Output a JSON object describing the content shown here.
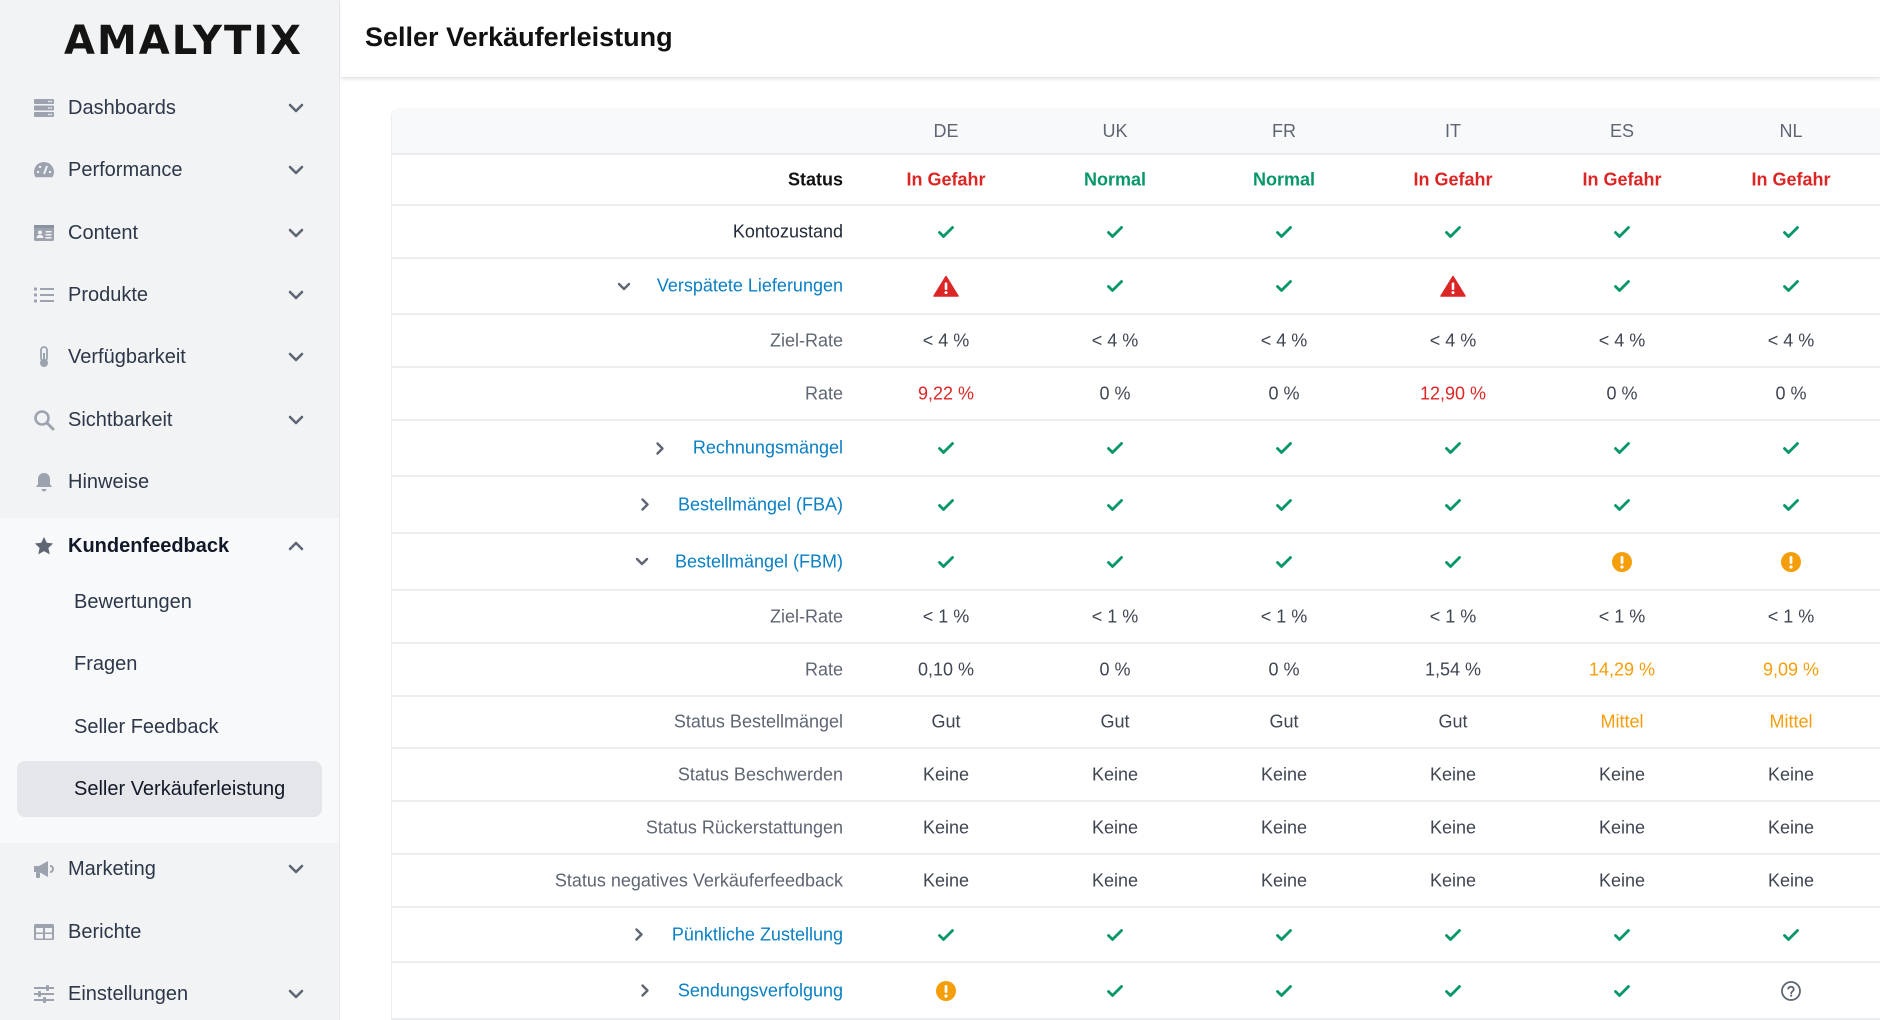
{
  "app": {
    "logo": "AMALYTIX"
  },
  "sidebar": {
    "items": [
      {
        "label": "Dashboards",
        "icon": "server-icon",
        "expandable": true,
        "expanded": false
      },
      {
        "label": "Performance",
        "icon": "gauge-icon",
        "expandable": true,
        "expanded": false
      },
      {
        "label": "Content",
        "icon": "id-card-icon",
        "expandable": true,
        "expanded": false
      },
      {
        "label": "Produkte",
        "icon": "list-icon",
        "expandable": true,
        "expanded": false
      },
      {
        "label": "Verfügbarkeit",
        "icon": "thermometer-icon",
        "expandable": true,
        "expanded": false
      },
      {
        "label": "Sichtbarkeit",
        "icon": "search-icon",
        "expandable": true,
        "expanded": false
      },
      {
        "label": "Hinweise",
        "icon": "bell-icon",
        "expandable": false
      },
      {
        "label": "Kundenfeedback",
        "icon": "star-icon",
        "expandable": true,
        "expanded": true
      },
      {
        "label": "Marketing",
        "icon": "megaphone-icon",
        "expandable": true,
        "expanded": false
      },
      {
        "label": "Berichte",
        "icon": "table-icon",
        "expandable": false
      },
      {
        "label": "Einstellungen",
        "icon": "sliders-icon",
        "expandable": true,
        "expanded": false
      }
    ],
    "kundenfeedback_children": [
      {
        "label": "Bewertungen",
        "selected": false
      },
      {
        "label": "Fragen",
        "selected": false
      },
      {
        "label": "Seller Feedback",
        "selected": false
      },
      {
        "label": "Seller Verkäuferleistung",
        "selected": true
      }
    ]
  },
  "header": {
    "title": "Seller Verkäuferleistung"
  },
  "colors": {
    "danger": "#dc2626",
    "success": "#059669",
    "warning": "#f59e0b",
    "link": "#0a7fc4"
  },
  "table": {
    "columns": [
      "DE",
      "UK",
      "FR",
      "IT",
      "ES",
      "NL"
    ],
    "rows": [
      {
        "label": "Status",
        "style": "strong",
        "cells": [
          {
            "text": "In Gefahr",
            "tone": "red",
            "bold": true
          },
          {
            "text": "Normal",
            "tone": "green",
            "bold": true
          },
          {
            "text": "Normal",
            "tone": "green",
            "bold": true
          },
          {
            "text": "In Gefahr",
            "tone": "red",
            "bold": true
          },
          {
            "text": "In Gefahr",
            "tone": "red",
            "bold": true
          },
          {
            "text": "In Gefahr",
            "tone": "red",
            "bold": true
          }
        ]
      },
      {
        "label": "Kontozustand",
        "style": "dark",
        "cells": [
          {
            "icon": "check"
          },
          {
            "icon": "check"
          },
          {
            "icon": "check"
          },
          {
            "icon": "check"
          },
          {
            "icon": "check"
          },
          {
            "icon": "check"
          }
        ]
      },
      {
        "label": "Verspätete Lieferungen",
        "style": "link",
        "toggle": "expanded",
        "tall": true,
        "cells": [
          {
            "icon": "warning-triangle"
          },
          {
            "icon": "check"
          },
          {
            "icon": "check"
          },
          {
            "icon": "warning-triangle"
          },
          {
            "icon": "check"
          },
          {
            "icon": "check"
          }
        ]
      },
      {
        "label": "Ziel-Rate",
        "style": "muted",
        "cells": [
          {
            "text": "< 4 %"
          },
          {
            "text": "< 4 %"
          },
          {
            "text": "< 4 %"
          },
          {
            "text": "< 4 %"
          },
          {
            "text": "< 4 %"
          },
          {
            "text": "< 4 %"
          }
        ]
      },
      {
        "label": "Rate",
        "style": "muted",
        "cells": [
          {
            "text": "9,22 %",
            "tone": "red"
          },
          {
            "text": "0 %"
          },
          {
            "text": "0 %"
          },
          {
            "text": "12,90 %",
            "tone": "red"
          },
          {
            "text": "0 %"
          },
          {
            "text": "0 %"
          }
        ]
      },
      {
        "label": "Rechnungsmängel",
        "style": "link",
        "toggle": "collapsed",
        "tall": true,
        "cells": [
          {
            "icon": "check"
          },
          {
            "icon": "check"
          },
          {
            "icon": "check"
          },
          {
            "icon": "check"
          },
          {
            "icon": "check"
          },
          {
            "icon": "check"
          }
        ]
      },
      {
        "label": "Bestellmängel (FBA)",
        "style": "link",
        "toggle": "collapsed",
        "tall": true,
        "cells": [
          {
            "icon": "check"
          },
          {
            "icon": "check"
          },
          {
            "icon": "check"
          },
          {
            "icon": "check"
          },
          {
            "icon": "check"
          },
          {
            "icon": "check"
          }
        ]
      },
      {
        "label": "Bestellmängel (FBM)",
        "style": "link",
        "toggle": "expanded",
        "tall": true,
        "cells": [
          {
            "icon": "check"
          },
          {
            "icon": "check"
          },
          {
            "icon": "check"
          },
          {
            "icon": "check"
          },
          {
            "icon": "exclamation-circle"
          },
          {
            "icon": "exclamation-circle"
          }
        ]
      },
      {
        "label": "Ziel-Rate",
        "style": "muted",
        "cells": [
          {
            "text": "< 1 %"
          },
          {
            "text": "< 1 %"
          },
          {
            "text": "< 1 %"
          },
          {
            "text": "< 1 %"
          },
          {
            "text": "< 1 %"
          },
          {
            "text": "< 1 %"
          }
        ]
      },
      {
        "label": "Rate",
        "style": "muted",
        "cells": [
          {
            "text": "0,10 %"
          },
          {
            "text": "0 %"
          },
          {
            "text": "0 %"
          },
          {
            "text": "1,54 %"
          },
          {
            "text": "14,29 %",
            "tone": "orange"
          },
          {
            "text": "9,09 %",
            "tone": "orange"
          }
        ]
      },
      {
        "label": "Status Bestellmängel",
        "style": "muted",
        "cells": [
          {
            "text": "Gut"
          },
          {
            "text": "Gut"
          },
          {
            "text": "Gut"
          },
          {
            "text": "Gut"
          },
          {
            "text": "Mittel",
            "tone": "orange"
          },
          {
            "text": "Mittel",
            "tone": "orange"
          }
        ]
      },
      {
        "label": "Status Beschwerden",
        "style": "muted",
        "cells": [
          {
            "text": "Keine"
          },
          {
            "text": "Keine"
          },
          {
            "text": "Keine"
          },
          {
            "text": "Keine"
          },
          {
            "text": "Keine"
          },
          {
            "text": "Keine"
          }
        ]
      },
      {
        "label": "Status Rückerstattungen",
        "style": "muted",
        "cells": [
          {
            "text": "Keine"
          },
          {
            "text": "Keine"
          },
          {
            "text": "Keine"
          },
          {
            "text": "Keine"
          },
          {
            "text": "Keine"
          },
          {
            "text": "Keine"
          }
        ]
      },
      {
        "label": "Status negatives Verkäuferfeedback",
        "style": "muted",
        "cells": [
          {
            "text": "Keine"
          },
          {
            "text": "Keine"
          },
          {
            "text": "Keine"
          },
          {
            "text": "Keine"
          },
          {
            "text": "Keine"
          },
          {
            "text": "Keine"
          }
        ]
      },
      {
        "label": "Pünktliche Zustellung",
        "style": "link",
        "toggle": "collapsed",
        "tall": true,
        "cells": [
          {
            "icon": "check"
          },
          {
            "icon": "check"
          },
          {
            "icon": "check"
          },
          {
            "icon": "check"
          },
          {
            "icon": "check"
          },
          {
            "icon": "check"
          }
        ]
      },
      {
        "label": "Sendungsverfolgung",
        "style": "link",
        "toggle": "collapsed",
        "tall": true,
        "cells": [
          {
            "icon": "exclamation-circle"
          },
          {
            "icon": "check"
          },
          {
            "icon": "check"
          },
          {
            "icon": "check"
          },
          {
            "icon": "check"
          },
          {
            "icon": "question-circle"
          }
        ]
      }
    ]
  }
}
